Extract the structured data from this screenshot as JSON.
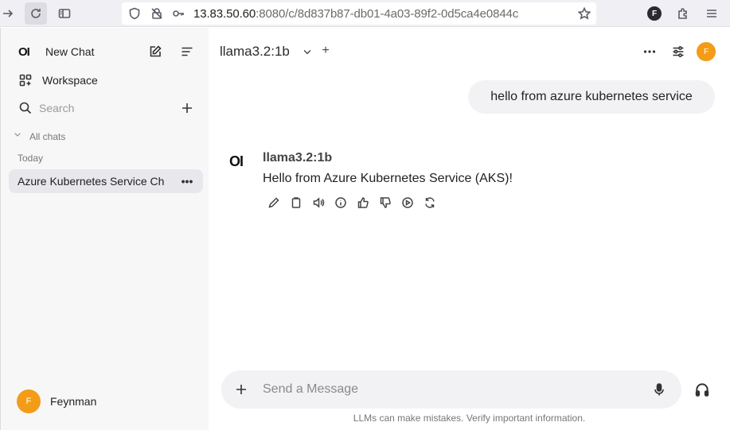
{
  "browser": {
    "url_host": "13.83.50.60",
    "url_rest": ":8080/c/8d837b87-db01-4a03-89f2-0d5ca4e0844c",
    "profile_initial": "F"
  },
  "sidebar": {
    "logo": "OI",
    "new_chat_label": "New Chat",
    "workspace_label": "Workspace",
    "search_placeholder": "Search",
    "all_chats_label": "All chats",
    "today_label": "Today",
    "chats": [
      {
        "title": "Azure Kubernetes Service Ch"
      }
    ],
    "more_label": "•••",
    "user": {
      "initial": "F",
      "name": "Feynman"
    }
  },
  "main": {
    "model_name": "llama3.2:1b",
    "add_label": "+",
    "avatar_initial": "F",
    "user_message": "hello from azure kubernetes service",
    "assistant": {
      "logo": "OI",
      "name": "llama3.2:1b",
      "message": "Hello from Azure Kubernetes Service (AKS)!"
    },
    "composer": {
      "placeholder": "Send a Message",
      "value": ""
    },
    "disclaimer": "LLMs can make mistakes. Verify important information."
  },
  "colors": {
    "avatar": "#f39c18",
    "sidebar_bg": "#f7f7f8",
    "chat_item_bg": "#e8e8ec"
  }
}
